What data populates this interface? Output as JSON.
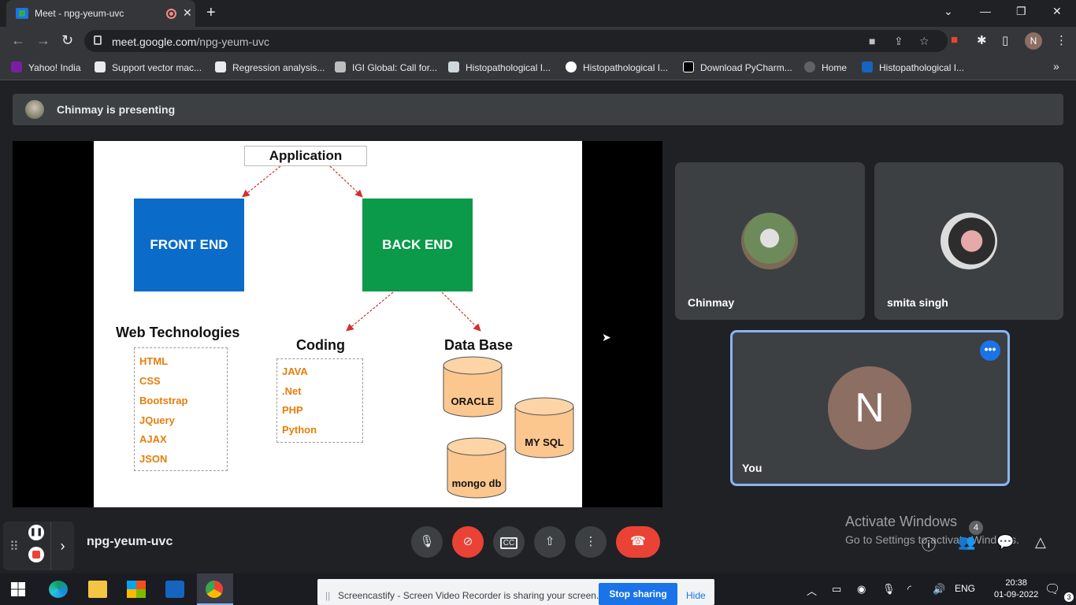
{
  "browser": {
    "tab_title": "Meet - npg-yeum-uvc",
    "new_tab_label": "+",
    "close_tab_label": "✕",
    "url_host": "meet.google.com",
    "url_path": "/npg-yeum-uvc",
    "profile_initial": "N"
  },
  "bookmarks": [
    {
      "label": "Yahoo! India",
      "icon": "yahoo-icon"
    },
    {
      "label": "Support vector mac...",
      "icon": "wikipedia-icon"
    },
    {
      "label": "Regression analysis...",
      "icon": "wikipedia-icon"
    },
    {
      "label": "IGI Global: Call for...",
      "icon": "igi-icon"
    },
    {
      "label": "Histopathological I...",
      "icon": "document-icon"
    },
    {
      "label": "Histopathological I...",
      "icon": "google-icon"
    },
    {
      "label": "Download PyCharm...",
      "icon": "jetbrains-icon"
    },
    {
      "label": "Home",
      "icon": "globe-icon"
    },
    {
      "label": "Histopathological I...",
      "icon": "ieee-icon"
    }
  ],
  "meet": {
    "presenting_text": "Chinmay is presenting",
    "meeting_code": "npg-yeum-uvc",
    "participants": [
      {
        "name": "Chinmay"
      },
      {
        "name": "smita singh"
      }
    ],
    "self": {
      "name": "You",
      "initial": "N"
    },
    "people_count": "4",
    "activate_line1": "Activate Windows",
    "activate_line2": "Go to Settings to activate Windows."
  },
  "slide": {
    "title": "Application",
    "front_end": "FRONT END",
    "back_end": "BACK END",
    "web_tech_heading": "Web Technologies",
    "web_tech_items": [
      "HTML",
      "CSS",
      "Bootstrap",
      "JQuery",
      "AJAX",
      "JSON"
    ],
    "coding_heading": "Coding",
    "coding_items": [
      "JAVA",
      ".Net",
      "PHP",
      "Python"
    ],
    "database_heading": "Data Base",
    "databases": [
      "ORACLE",
      "MY SQL",
      "mongo db"
    ],
    "colors": {
      "front_end": "#0b6bc8",
      "back_end": "#0a9a4a",
      "list_text": "#e67e0a",
      "cylinder": "#fbc78e"
    }
  },
  "sharing_bar": {
    "message": "Screencastify - Screen Video Recorder is sharing your screen.",
    "stop_label": "Stop sharing",
    "hide_label": "Hide"
  },
  "taskbar": {
    "language": "ENG",
    "time": "20:38",
    "date": "01-09-2022",
    "notifications": "3"
  }
}
